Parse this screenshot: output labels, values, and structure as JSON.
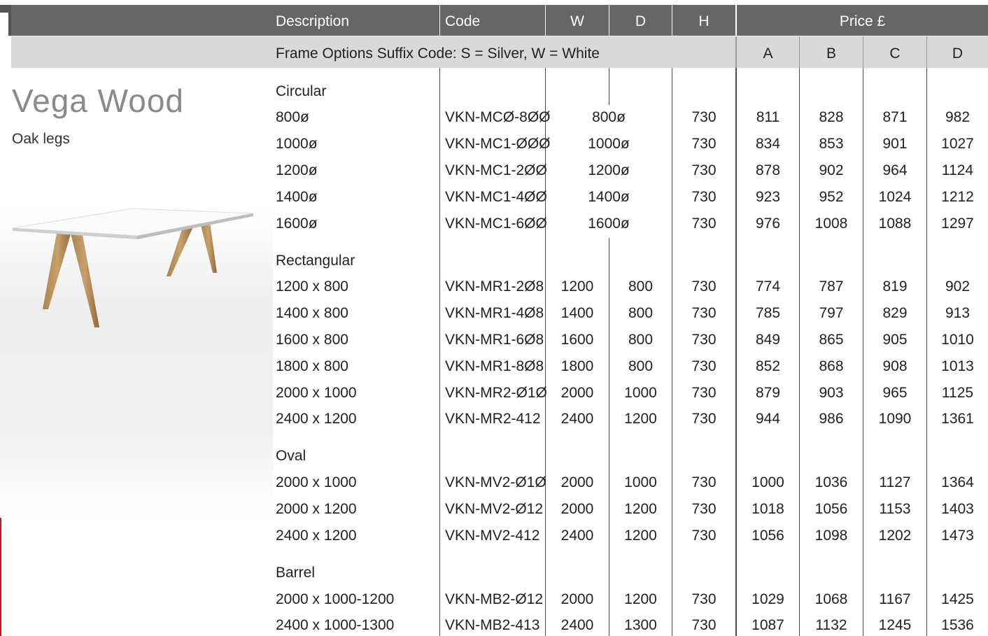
{
  "header": {
    "description": "Description",
    "code": "Code",
    "w": "W",
    "d": "D",
    "h": "H",
    "price": "Price £"
  },
  "subheader": {
    "frame_options": "Frame Options Suffix Code: S = Silver,  W = White",
    "price_bands": [
      "A",
      "B",
      "C",
      "D"
    ]
  },
  "product": {
    "title": "Vega Wood",
    "subtitle": "Oak legs"
  },
  "groups": [
    {
      "name": "Circular",
      "rows": [
        {
          "desc": "800ø",
          "code": "VKN-MCØ-8ØØ",
          "size": "800ø",
          "h": "730",
          "prices": [
            "811",
            "828",
            "871",
            "982"
          ]
        },
        {
          "desc": "1000ø",
          "code": "VKN-MC1-ØØØ",
          "size": "1000ø",
          "h": "730",
          "prices": [
            "834",
            "853",
            "901",
            "1027"
          ]
        },
        {
          "desc": "1200ø",
          "code": "VKN-MC1-2ØØ",
          "size": "1200ø",
          "h": "730",
          "prices": [
            "878",
            "902",
            "964",
            "1124"
          ]
        },
        {
          "desc": "1400ø",
          "code": "VKN-MC1-4ØØ",
          "size": "1400ø",
          "h": "730",
          "prices": [
            "923",
            "952",
            "1024",
            "1212"
          ]
        },
        {
          "desc": "1600ø",
          "code": "VKN-MC1-6ØØ",
          "size": "1600ø",
          "h": "730",
          "prices": [
            "976",
            "1008",
            "1088",
            "1297"
          ]
        }
      ]
    },
    {
      "name": "Rectangular",
      "rows": [
        {
          "desc": "1200 x 800",
          "code": "VKN-MR1-2Ø8",
          "w": "1200",
          "d": "800",
          "h": "730",
          "prices": [
            "774",
            "787",
            "819",
            "902"
          ]
        },
        {
          "desc": "1400 x 800",
          "code": "VKN-MR1-4Ø8",
          "w": "1400",
          "d": "800",
          "h": "730",
          "prices": [
            "785",
            "797",
            "829",
            "913"
          ]
        },
        {
          "desc": "1600 x 800",
          "code": "VKN-MR1-6Ø8",
          "w": "1600",
          "d": "800",
          "h": "730",
          "prices": [
            "849",
            "865",
            "905",
            "1010"
          ]
        },
        {
          "desc": "1800 x 800",
          "code": "VKN-MR1-8Ø8",
          "w": "1800",
          "d": "800",
          "h": "730",
          "prices": [
            "852",
            "868",
            "908",
            "1013"
          ]
        },
        {
          "desc": "2000 x 1000",
          "code": "VKN-MR2-Ø1Ø",
          "w": "2000",
          "d": "1000",
          "h": "730",
          "prices": [
            "879",
            "903",
            "965",
            "1125"
          ]
        },
        {
          "desc": "2400 x 1200",
          "code": "VKN-MR2-412",
          "w": "2400",
          "d": "1200",
          "h": "730",
          "prices": [
            "944",
            "986",
            "1090",
            "1361"
          ]
        }
      ]
    },
    {
      "name": "Oval",
      "rows": [
        {
          "desc": "2000 x 1000",
          "code": "VKN-MV2-Ø1Ø",
          "w": "2000",
          "d": "1000",
          "h": "730",
          "prices": [
            "1000",
            "1036",
            "1127",
            "1364"
          ]
        },
        {
          "desc": "2000 x 1200",
          "code": "VKN-MV2-Ø12",
          "w": "2000",
          "d": "1200",
          "h": "730",
          "prices": [
            "1018",
            "1056",
            "1153",
            "1403"
          ]
        },
        {
          "desc": "2400 x 1200",
          "code": "VKN-MV2-412",
          "w": "2400",
          "d": "1200",
          "h": "730",
          "prices": [
            "1056",
            "1098",
            "1202",
            "1473"
          ]
        }
      ]
    },
    {
      "name": "Barrel",
      "rows": [
        {
          "desc": "2000 x 1000-1200",
          "code": "VKN-MB2-Ø12",
          "w": "2000",
          "d": "1200",
          "h": "730",
          "prices": [
            "1029",
            "1068",
            "1167",
            "1425"
          ]
        },
        {
          "desc": "2400 x 1000-1300",
          "code": "VKN-MB2-413",
          "w": "2400",
          "d": "1300",
          "h": "730",
          "prices": [
            "1087",
            "1132",
            "1245",
            "1536"
          ]
        }
      ]
    }
  ],
  "colors": {
    "header_bg": "#666666",
    "subheader_bg": "#d9d9d9",
    "title_color": "#8a8a8a",
    "accent_red": "#b02020"
  }
}
